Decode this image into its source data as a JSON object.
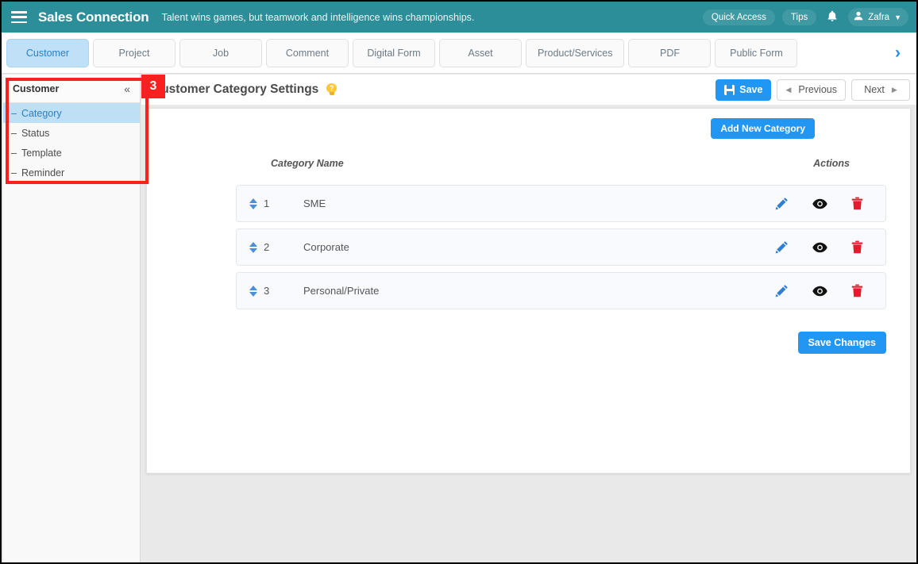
{
  "topbar": {
    "menu_icon": "hamburger-icon",
    "brand": "Sales Connection",
    "tagline": "Talent wins games, but teamwork and intelligence wins championships.",
    "quick_access": "Quick Access",
    "tips": "Tips",
    "bell_icon": "bell-icon",
    "user_name": "Zafra",
    "caret": "⌵",
    "bg_color": "#2b8e99"
  },
  "tabs": {
    "items": [
      {
        "label": "Customer",
        "active": true
      },
      {
        "label": "Project",
        "active": false
      },
      {
        "label": "Job",
        "active": false
      },
      {
        "label": "Comment",
        "active": false
      },
      {
        "label": "Digital Form",
        "active": false
      },
      {
        "label": "Asset",
        "active": false
      },
      {
        "label": "Product/Services",
        "active": false
      },
      {
        "label": "PDF",
        "active": false
      },
      {
        "label": "Public Form",
        "active": false
      }
    ],
    "next_arrow": "›",
    "active_color": "#bfe0f7"
  },
  "sidebar": {
    "title": "Customer",
    "collapse_icon": "«",
    "items": [
      {
        "dash": "–",
        "label": "Category",
        "active": true
      },
      {
        "dash": "–",
        "label": "Status",
        "active": false
      },
      {
        "dash": "–",
        "label": "Template",
        "active": false
      },
      {
        "dash": "–",
        "label": "Reminder",
        "active": false
      }
    ]
  },
  "annotation": {
    "badge": "3",
    "color": "#f92020"
  },
  "page": {
    "title": "Customer Category Settings",
    "help_icon": "lightbulb-help-icon",
    "help_glyph": "?",
    "save_label": "Save",
    "save_icon": "floppy-disk-icon",
    "previous_label": "Previous",
    "previous_icon": "◀",
    "next_label": "Next",
    "next_icon": "▶"
  },
  "card": {
    "add_button": "Add New Category",
    "columns": {
      "name": "Category Name",
      "actions": "Actions"
    },
    "rows": [
      {
        "num": "1",
        "name": "SME"
      },
      {
        "num": "2",
        "name": "Corporate"
      },
      {
        "num": "3",
        "name": "Personal/Private"
      }
    ],
    "row_actions": {
      "edit_icon": "pencil-edit-icon",
      "view_icon": "eye-view-icon",
      "delete_icon": "trash-delete-icon"
    },
    "save_changes": "Save Changes"
  }
}
